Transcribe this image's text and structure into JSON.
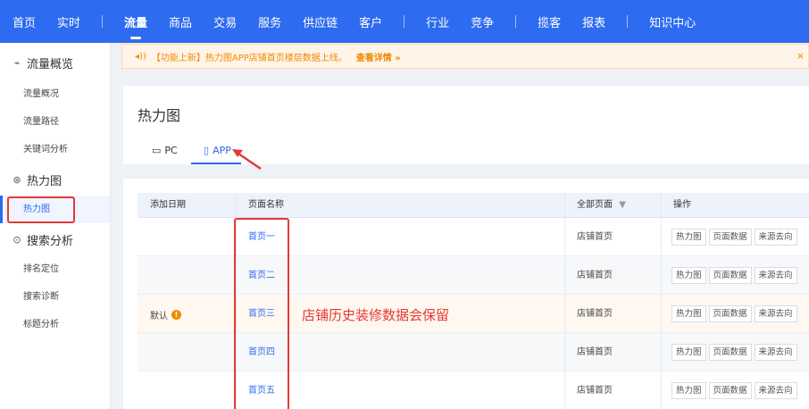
{
  "topnav": {
    "items": [
      "首页",
      "实时",
      "流量",
      "商品",
      "交易",
      "服务",
      "供应链",
      "客户",
      "行业",
      "竞争",
      "揽客",
      "报表",
      "知识中心"
    ]
  },
  "sidebar": {
    "group1": {
      "label": "流量概览",
      "icon": "trend-icon"
    },
    "items1": [
      "流量概况",
      "流量路径",
      "关键词分析"
    ],
    "group2": {
      "label": "热力图",
      "icon": "heatmap-icon"
    },
    "items2": [
      "热力图"
    ],
    "group3": {
      "label": "搜索分析",
      "icon": "search-icon"
    },
    "items3": [
      "排名定位",
      "搜索诊断",
      "标题分析"
    ]
  },
  "notice": {
    "icon": "speaker-icon",
    "text": "【功能上新】热力图APP店铺首页楼层数据上线。",
    "link": "查看详情 »",
    "close": "×"
  },
  "card": {
    "title": "热力图",
    "tabs": [
      {
        "label": "PC",
        "icon": "monitor-icon"
      },
      {
        "label": "APP",
        "icon": "phone-icon"
      }
    ]
  },
  "table": {
    "headers": {
      "date": "添加日期",
      "name": "页面名称",
      "all": "全部页面",
      "op": "操作"
    },
    "date_value": "默认",
    "rows": [
      {
        "name": "首页一",
        "page": "店铺首页"
      },
      {
        "name": "首页二",
        "page": "店铺首页"
      },
      {
        "name": "首页三",
        "page": "店铺首页"
      },
      {
        "name": "首页四",
        "page": "店铺首页"
      },
      {
        "name": "首页五",
        "page": "店铺首页"
      }
    ],
    "actions": [
      "热力图",
      "页面数据",
      "来源去向"
    ]
  },
  "annotation": "店铺历史装修数据会保留",
  "colors": {
    "brand": "#2d6bf0",
    "highlight": "#e53935",
    "notice": "#f08a00"
  }
}
